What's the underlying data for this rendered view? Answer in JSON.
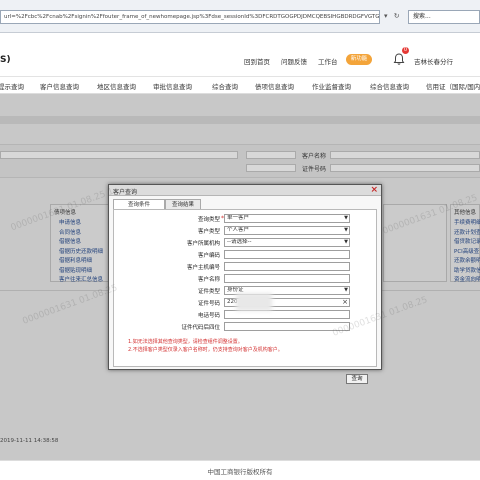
{
  "browser": {
    "url": "url=%2Fcbc%2Fcnab%2Fsignin%2Ffouter_frame_of_newhomepage.jsp%3Fdse_sessionId%3DFCRDTGOGPDJDMCQEBSIHGBDRDGFVGTGIBEJGHY",
    "search_placeholder": "搜索..."
  },
  "header": {
    "brand": "S)",
    "links": [
      "回到首页",
      "问题反馈",
      "工作台"
    ],
    "workbench_badge": "新功能",
    "notification_count": "0",
    "branch": "吉林长春分行"
  },
  "nav": {
    "items": [
      "提示查询",
      "客户信息查询",
      "地区信息查询",
      "审批信息查询",
      "综合查询",
      "债项信息查询",
      "作业监督查询",
      "综合信息查询",
      "信用证（国际/国内"
    ]
  },
  "background": {
    "labels": [
      "客户名称",
      "证件号码"
    ],
    "left_panel": {
      "title": "债项信息",
      "links": [
        "申请信息",
        "合同信息",
        "借据信息",
        "借据历史还款明细",
        "借据利息明细",
        "借据贴现明细",
        "客户往来汇总信息"
      ]
    },
    "right_panel": {
      "title": "其他信息",
      "links": [
        "手续费明细",
        "还款计划查",
        "借贷款记录",
        "PCI高级查",
        "还款余额明",
        "助学贷款信",
        "资金流向明"
      ]
    },
    "timestamp": "2019-11-11 14:38:58",
    "copyright": "中国工商银行版权所有"
  },
  "dialog": {
    "title": "客户查询",
    "tabs": [
      "查询条件",
      "查询结果"
    ],
    "fields": [
      {
        "label": "查询类型",
        "value": "单一客户",
        "required": true,
        "dropdown": true
      },
      {
        "label": "客户类型",
        "value": "个人客户",
        "required": false,
        "dropdown": true
      },
      {
        "label": "客户所属机构",
        "value": "--请选择--",
        "required": false,
        "dropdown": true
      },
      {
        "label": "客户编码",
        "value": "",
        "required": false,
        "dropdown": false
      },
      {
        "label": "客户主机编号",
        "value": "",
        "required": false,
        "dropdown": false
      },
      {
        "label": "客户名称",
        "value": "",
        "required": false,
        "dropdown": false
      },
      {
        "label": "证件类型",
        "value": "身份证",
        "required": false,
        "dropdown": true
      },
      {
        "label": "证件号码",
        "value": "220",
        "required": false,
        "dropdown": false,
        "clear": "×"
      },
      {
        "label": "电话号码",
        "value": "",
        "required": false,
        "dropdown": false
      },
      {
        "label": "证件代码后四位",
        "value": "",
        "required": false,
        "dropdown": false
      }
    ],
    "notes": [
      "1.如无法选择其他查询类型，请检查组件调整设置。",
      "2.不选择客户类型仅录入客户名称时，仍支持查询对客户及机构客户。"
    ],
    "query_button": "查询"
  },
  "colors": {
    "accent_orange": "#f3a43a",
    "alert_red": "#d32f2f",
    "overlay_gray": "#c8c8c8"
  }
}
